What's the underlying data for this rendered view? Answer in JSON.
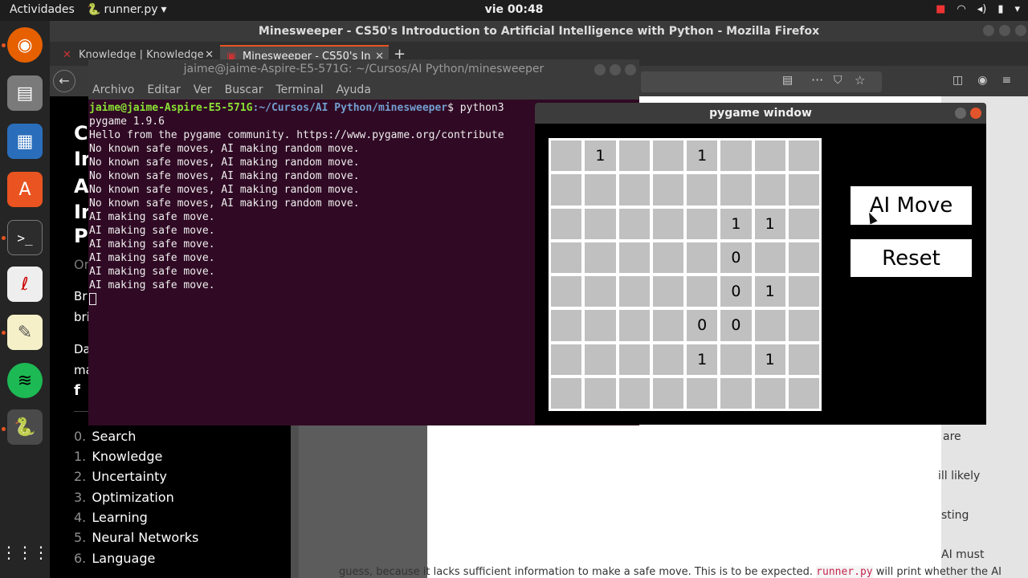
{
  "topbar": {
    "activities": "Actividades",
    "app_name": "runner.py",
    "clock": "vie 00:48"
  },
  "firefox": {
    "window_title": "Minesweeper - CS50's Introduction to Artificial Intelligence with Python - Mozilla Firefox",
    "tabs": [
      {
        "label": "Knowledge | Knowledge"
      },
      {
        "label": "Minesweeper - CS50's In"
      }
    ],
    "sidebar_fragments": [
      "C",
      "Ir",
      "A",
      "Ir",
      "P",
      "Or",
      "Br",
      "bri",
      "Da",
      "ma"
    ],
    "lectures": [
      {
        "num": "0.",
        "label": "Search"
      },
      {
        "num": "1.",
        "label": "Knowledge"
      },
      {
        "num": "2.",
        "label": "Uncertainty"
      },
      {
        "num": "3.",
        "label": "Optimization"
      },
      {
        "num": "4.",
        "label": "Learning"
      },
      {
        "num": "5.",
        "label": "Neural Networks"
      },
      {
        "num": "6.",
        "label": "Language"
      }
    ],
    "content_fragments": [
      "are",
      "ill likely",
      "sting",
      "AI must"
    ],
    "bottom_line": {
      "before": "guess, because it lacks sufficient information to make a safe move. This is to be expected.",
      "code": "runner.py",
      "after": "will print whether the AI"
    }
  },
  "terminal": {
    "title": "jaime@jaime-Aspire-E5-571G: ~/Cursos/AI Python/minesweeper",
    "menu": [
      "Archivo",
      "Editar",
      "Ver",
      "Buscar",
      "Terminal",
      "Ayuda"
    ],
    "prompt_user": "jaime@jaime-Aspire-E5-571G",
    "prompt_path": ":~/Cursos/AI Python/minesweeper",
    "prompt_cmd": "$ python3",
    "lines": [
      "pygame 1.9.6",
      "Hello from the pygame community. https://www.pygame.org/contribute",
      "No known safe moves, AI making random move.",
      "No known safe moves, AI making random move.",
      "No known safe moves, AI making random move.",
      "No known safe moves, AI making random move.",
      "No known safe moves, AI making random move.",
      "AI making safe move.",
      "AI making safe move.",
      "AI making safe move.",
      "AI making safe move.",
      "AI making safe move.",
      "AI making safe move."
    ]
  },
  "pygame": {
    "title": "pygame window",
    "ai_move_label": "AI Move",
    "reset_label": "Reset",
    "board": [
      [
        "",
        "1",
        "",
        "",
        "1",
        "",
        "",
        ""
      ],
      [
        "",
        "",
        "",
        "",
        "",
        "",
        "",
        ""
      ],
      [
        "",
        "",
        "",
        "",
        "",
        "1",
        "1",
        ""
      ],
      [
        "",
        "",
        "",
        "",
        "",
        "0",
        "",
        ""
      ],
      [
        "",
        "",
        "",
        "",
        "",
        "0",
        "1",
        ""
      ],
      [
        "",
        "",
        "",
        "",
        "0",
        "0",
        "",
        ""
      ],
      [
        "",
        "",
        "",
        "",
        "1",
        "",
        "1",
        ""
      ],
      [
        "",
        "",
        "",
        "",
        "",
        "",
        "",
        ""
      ]
    ]
  }
}
